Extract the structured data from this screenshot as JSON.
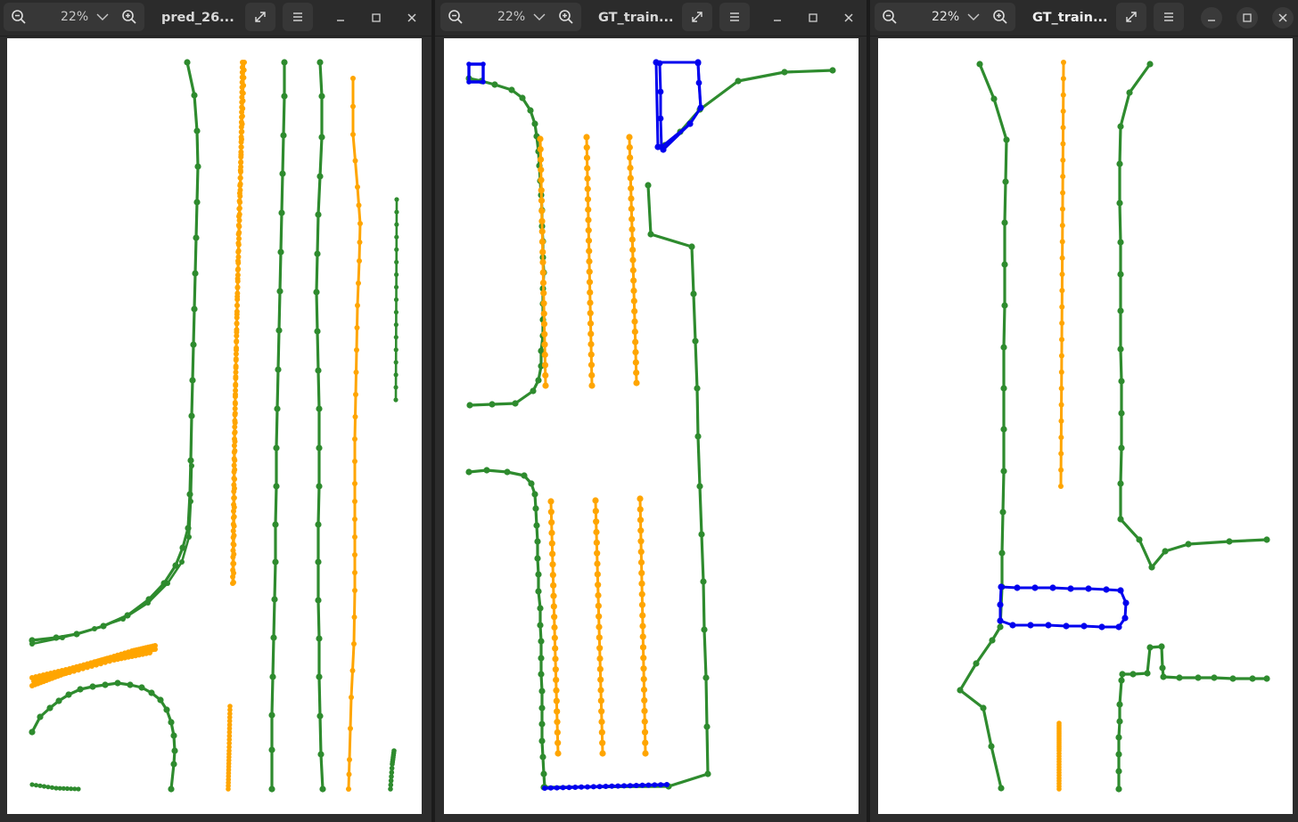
{
  "windows": [
    {
      "title": "pred_26...",
      "zoom": "22%",
      "colors": {
        "green": "#2e8b2e",
        "orange": "#ffa500",
        "blue": "#0000ee"
      }
    },
    {
      "title": "GT_train...",
      "zoom": "22%",
      "colors": {
        "green": "#2e8b2e",
        "orange": "#ffa500",
        "blue": "#0000ee"
      }
    },
    {
      "title": "GT_train...",
      "zoom": "22%",
      "colors": {
        "green": "#2e8b2e",
        "orange": "#ffa500",
        "blue": "#0000ee"
      }
    }
  ],
  "icons": {
    "zoom_out": "zoom-out-icon",
    "zoom_in": "zoom-in-icon",
    "dropdown": "chevron-down-icon",
    "fullscreen": "fullscreen-icon",
    "menu": "hamburger-menu-icon",
    "minimize": "minimize-icon",
    "maximize": "maximize-icon",
    "close": "close-icon"
  }
}
